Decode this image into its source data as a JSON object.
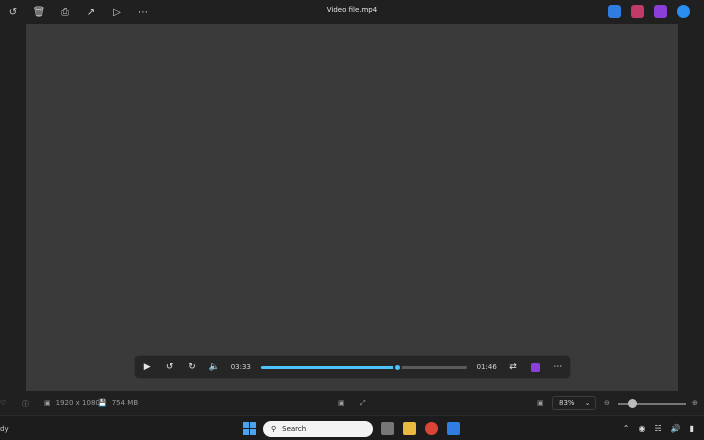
{
  "window": {
    "title": "Video file.mp4",
    "toolbar_icons": [
      "rotate-icon",
      "delete-icon",
      "print-icon",
      "share-icon",
      "slideshow-icon",
      "more-icon"
    ],
    "app_icons": [
      "edit-app-icon",
      "design-app-icon",
      "clipchamp-icon",
      "onedrive-icon"
    ]
  },
  "video": {
    "label": ""
  },
  "player": {
    "current_time": "03:33",
    "remaining_time": "01:46",
    "progress": 0.66
  },
  "status": {
    "resolution": "1920 x 1080",
    "size": "754 MB",
    "zoom": "83%"
  },
  "taskbar": {
    "left_text": "dy",
    "search_label": "Search"
  },
  "colors": {
    "accent": "#4cc2ff",
    "chrome": "#202020"
  }
}
